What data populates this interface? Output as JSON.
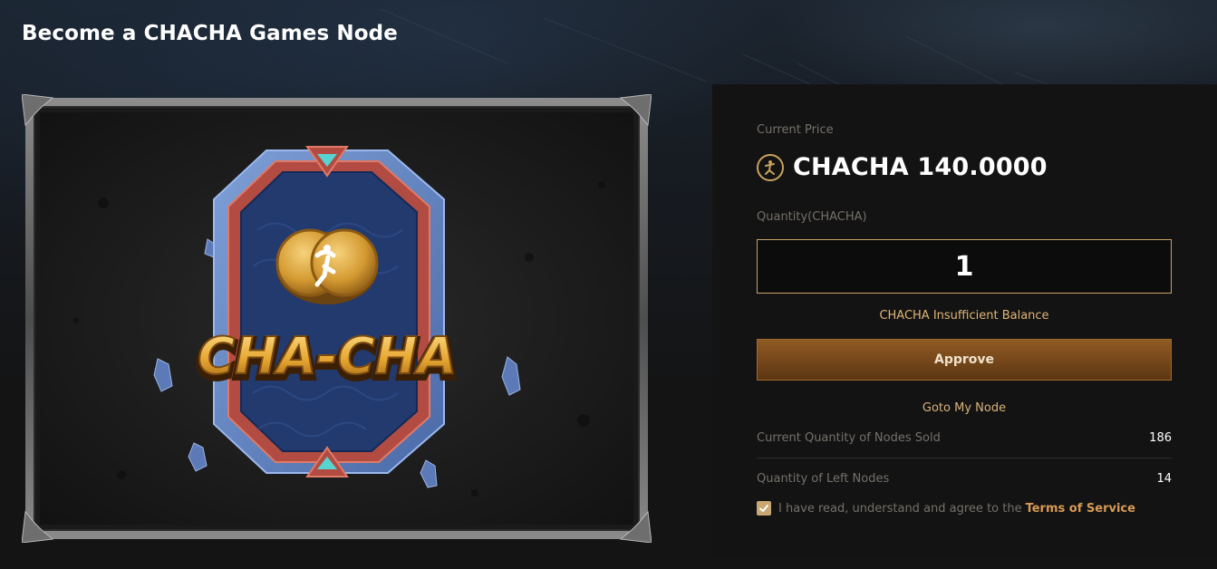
{
  "page": {
    "title": "Become a CHACHA Games Node"
  },
  "artwork": {
    "logo_text": "CHA-CHA"
  },
  "panel": {
    "current_price_label": "Current Price",
    "price": "CHACHA 140.0000",
    "quantity_label": "Quantity(CHACHA)",
    "quantity_value": "1",
    "warning": "CHACHA Insufficient Balance",
    "approve_label": "Approve",
    "goto_label": "Goto My Node",
    "stats": [
      {
        "label": "Current Quantity of Nodes Sold",
        "value": "186"
      },
      {
        "label": "Quantity of Left Nodes",
        "value": "14"
      }
    ],
    "agreement": {
      "checked": true,
      "text": "I have read, understand and agree to the",
      "link_label": "Terms of Service"
    }
  },
  "colors": {
    "accent_gold": "#c9a874",
    "approve_brown": "#7a4a1c",
    "warning": "#e0b574",
    "link": "#d99a55"
  },
  "icons": [
    "chacha-coin-icon",
    "checkmark-icon"
  ]
}
